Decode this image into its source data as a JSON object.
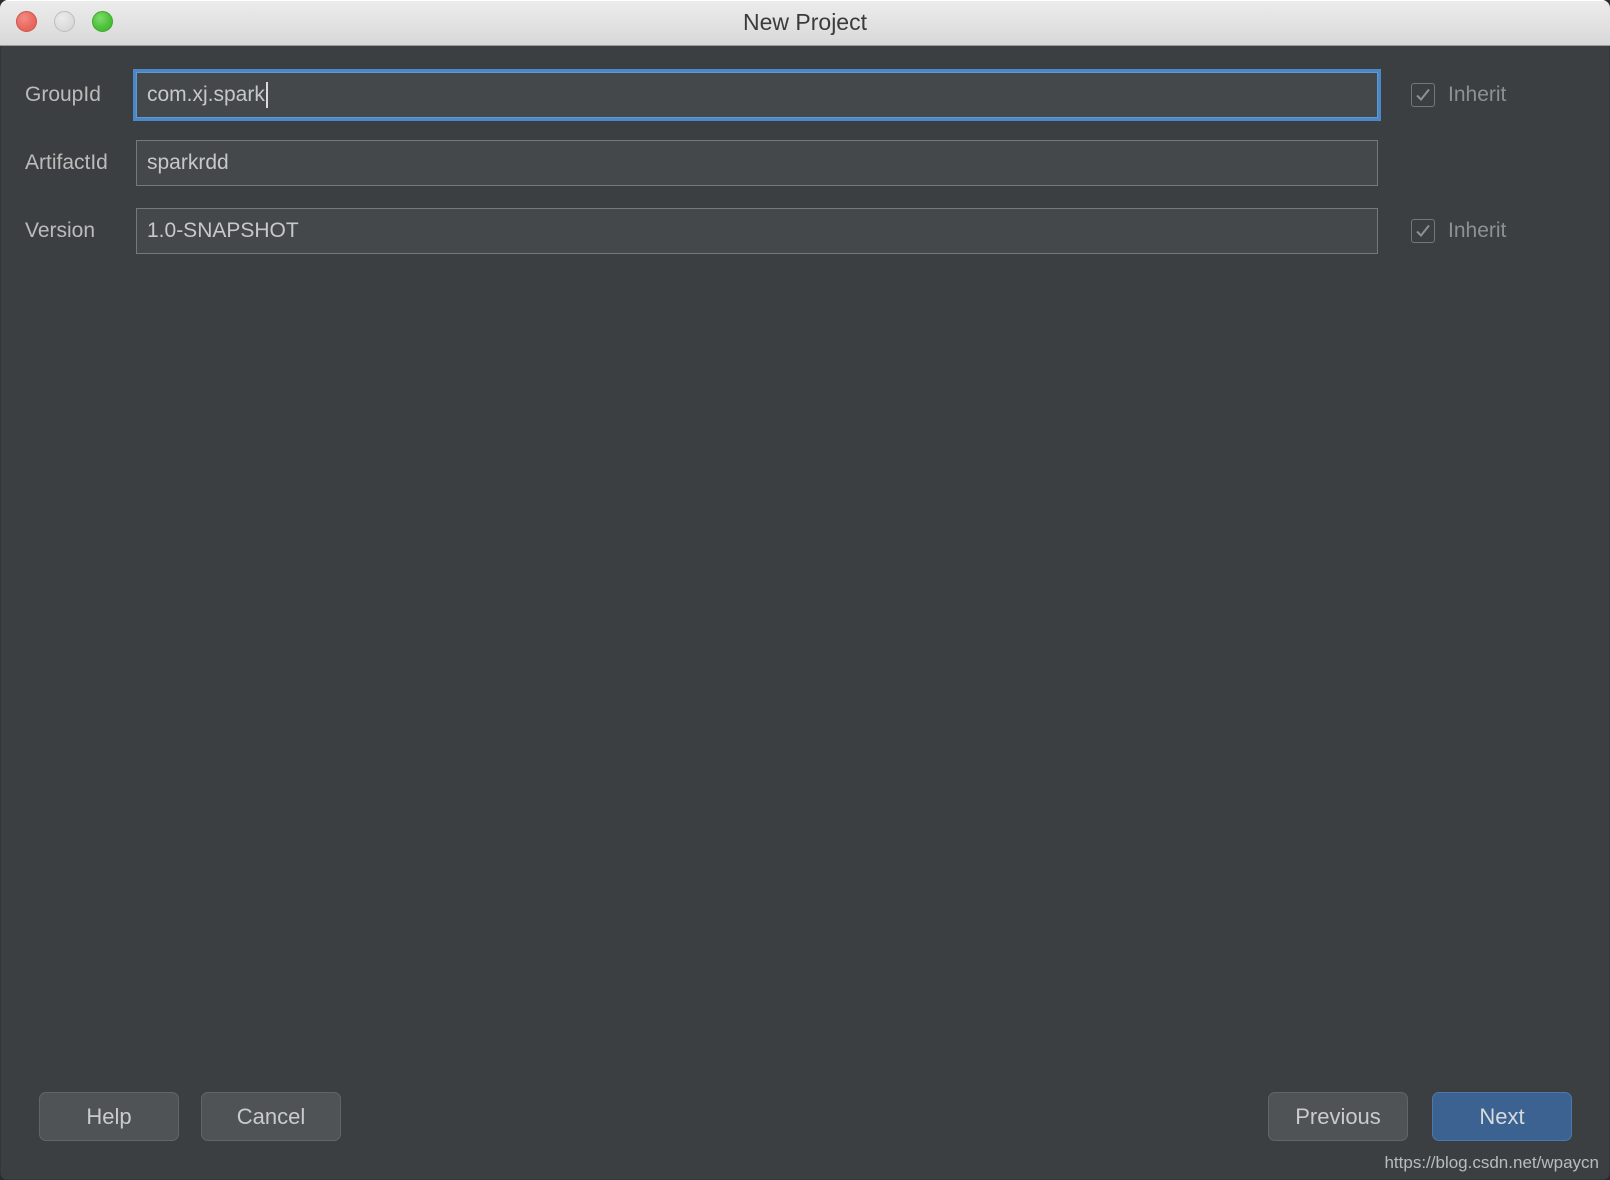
{
  "window": {
    "title": "New Project",
    "traffic_lights": [
      {
        "name": "close-button",
        "color": "#ea6a60"
      },
      {
        "name": "minimize-button",
        "color": "#dcdcdc"
      },
      {
        "name": "zoom-button",
        "color": "#4fc23c"
      }
    ]
  },
  "form": {
    "rows": [
      {
        "label": "GroupId",
        "value": "com.xj.spark",
        "placeholder": "",
        "focused": true,
        "has_inherit": true,
        "inherit_label": "Inherit",
        "inherit_checked": true,
        "inherit_enabled": false
      },
      {
        "label": "ArtifactId",
        "value": "sparkrdd",
        "placeholder": "",
        "focused": false,
        "has_inherit": false,
        "inherit_label": "",
        "inherit_checked": false,
        "inherit_enabled": false
      },
      {
        "label": "Version",
        "value": "1.0-SNAPSHOT",
        "placeholder": "",
        "focused": false,
        "has_inherit": true,
        "inherit_label": "Inherit",
        "inherit_checked": true,
        "inherit_enabled": false
      }
    ]
  },
  "footer": {
    "help_label": "Help",
    "cancel_label": "Cancel",
    "previous_label": "Previous",
    "next_label": "Next"
  },
  "watermark": "https://blog.csdn.net/wpaycn",
  "colors": {
    "dialog_background": "#3c3f41",
    "field_background": "#45484a",
    "field_border": "#75797c",
    "focus_ring": "#4a88c7",
    "default_button": "#3b6291",
    "label_text": "#bbbbbb",
    "titlebar_text": "#3b3b3b"
  }
}
